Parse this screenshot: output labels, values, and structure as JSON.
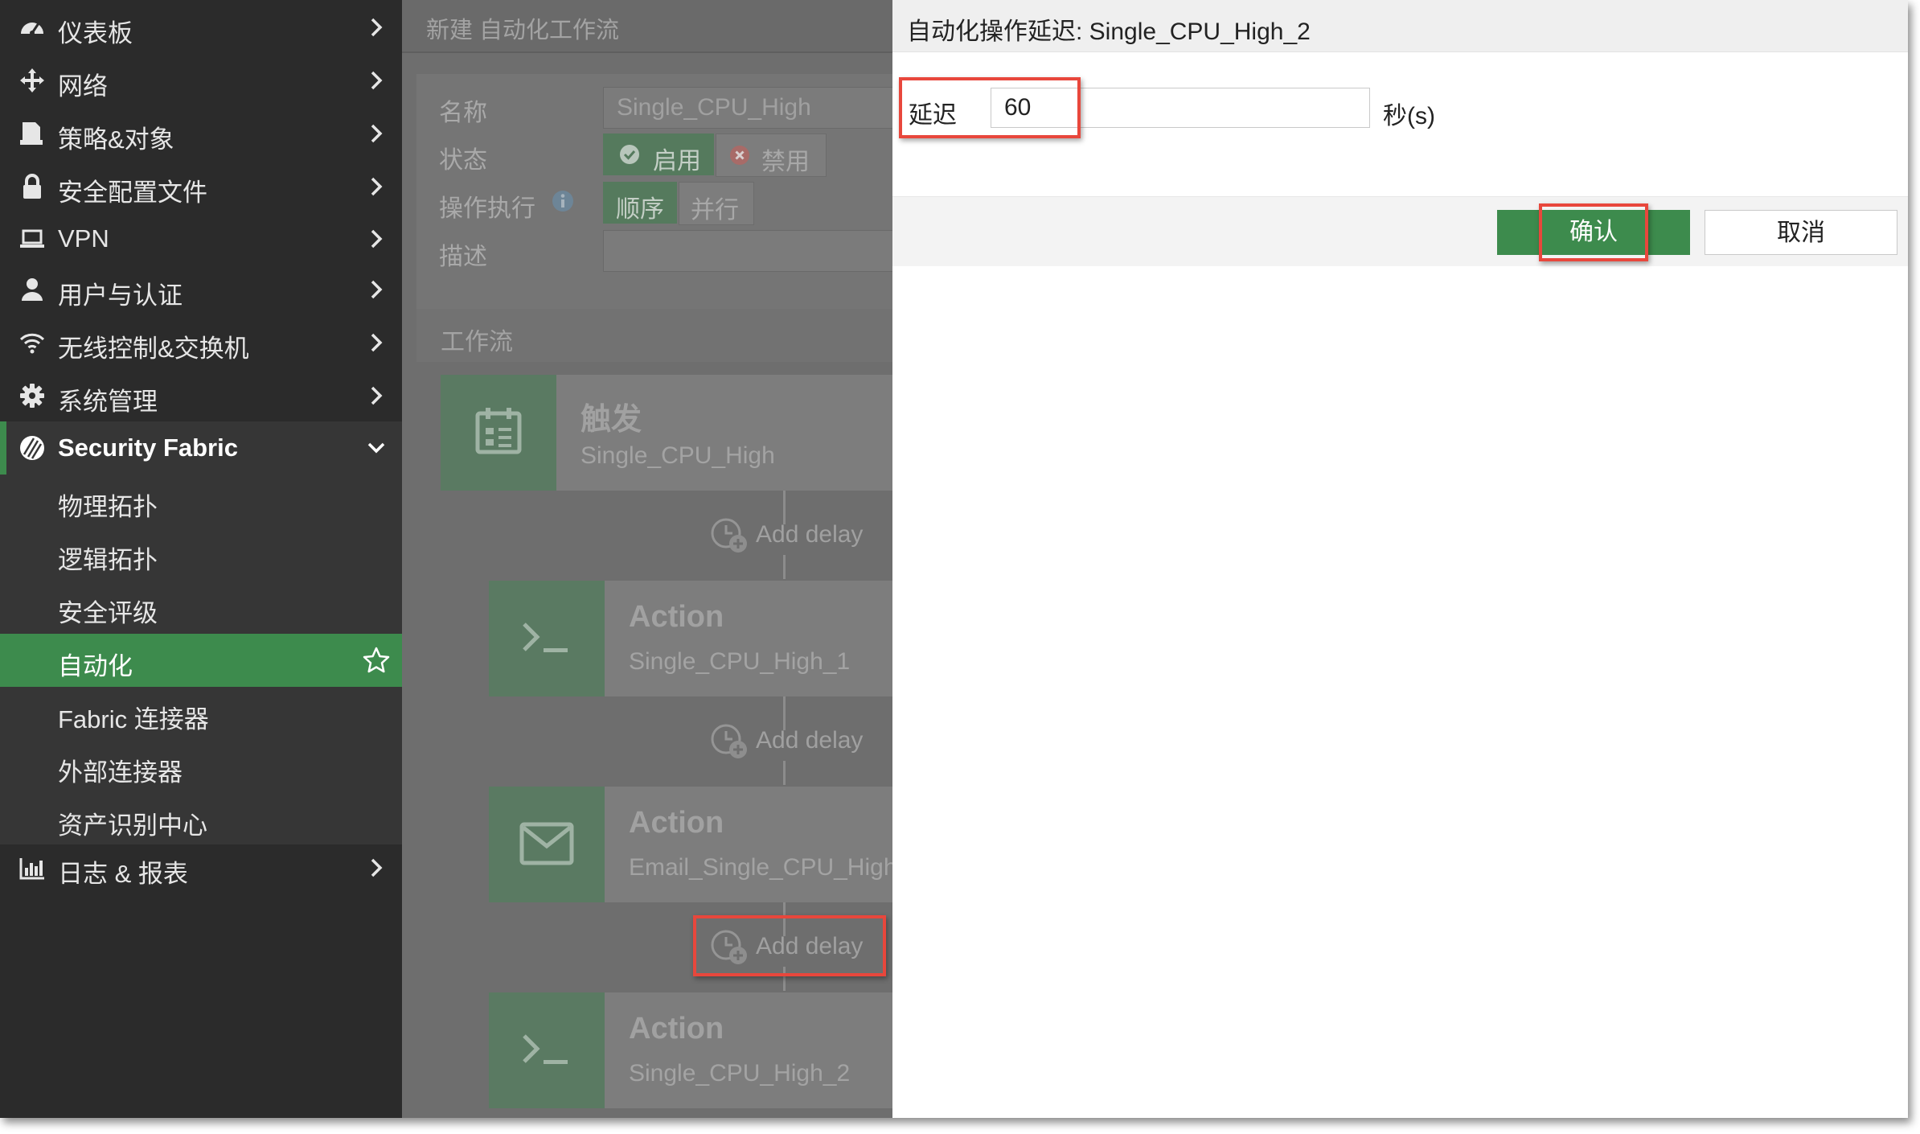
{
  "sidebar": {
    "items": [
      {
        "label": "仪表板"
      },
      {
        "label": "网络"
      },
      {
        "label": "策略&对象"
      },
      {
        "label": "安全配置文件"
      },
      {
        "label": "VPN"
      },
      {
        "label": "用户与认证"
      },
      {
        "label": "无线控制&交换机"
      },
      {
        "label": "系统管理"
      }
    ],
    "section": {
      "label": "Security Fabric"
    },
    "sub_items": [
      {
        "label": "物理拓扑"
      },
      {
        "label": "逻辑拓扑"
      },
      {
        "label": "安全评级"
      },
      {
        "label": "自动化"
      },
      {
        "label": "Fabric 连接器"
      },
      {
        "label": "外部连接器"
      },
      {
        "label": "资产识别中心"
      }
    ],
    "bottom_item": {
      "label": "日志 & 报表"
    }
  },
  "editor": {
    "title": "新建 自动化工作流",
    "name_label": "名称",
    "name_value": "Single_CPU_High",
    "status_label": "状态",
    "status_enable": "启用",
    "status_disable": "禁用",
    "exec_label": "操作执行",
    "exec_sequential": "顺序",
    "exec_parallel": "并行",
    "desc_label": "描述",
    "workflow_label": "工作流",
    "trigger": {
      "title": "触发",
      "name": "Single_CPU_High"
    },
    "actions": [
      {
        "title": "Action",
        "name": "Single_CPU_High_1",
        "icon": "terminal-icon"
      },
      {
        "title": "Action",
        "name": "Email_Single_CPU_High",
        "icon": "envelope-icon"
      },
      {
        "title": "Action",
        "name": "Single_CPU_High_2",
        "icon": "terminal-icon"
      }
    ],
    "add_delay_label": "Add delay"
  },
  "dialog": {
    "title": "自动化操作延迟: Single_CPU_High_2",
    "delay_label": "延迟",
    "delay_value": "60",
    "unit": "秒(s)",
    "ok_label": "确认",
    "cancel_label": "取消"
  },
  "colors": {
    "accent_green": "#3d8b4d",
    "highlight_red": "#e8473c",
    "sidebar_bg": "#2b2b2b"
  }
}
